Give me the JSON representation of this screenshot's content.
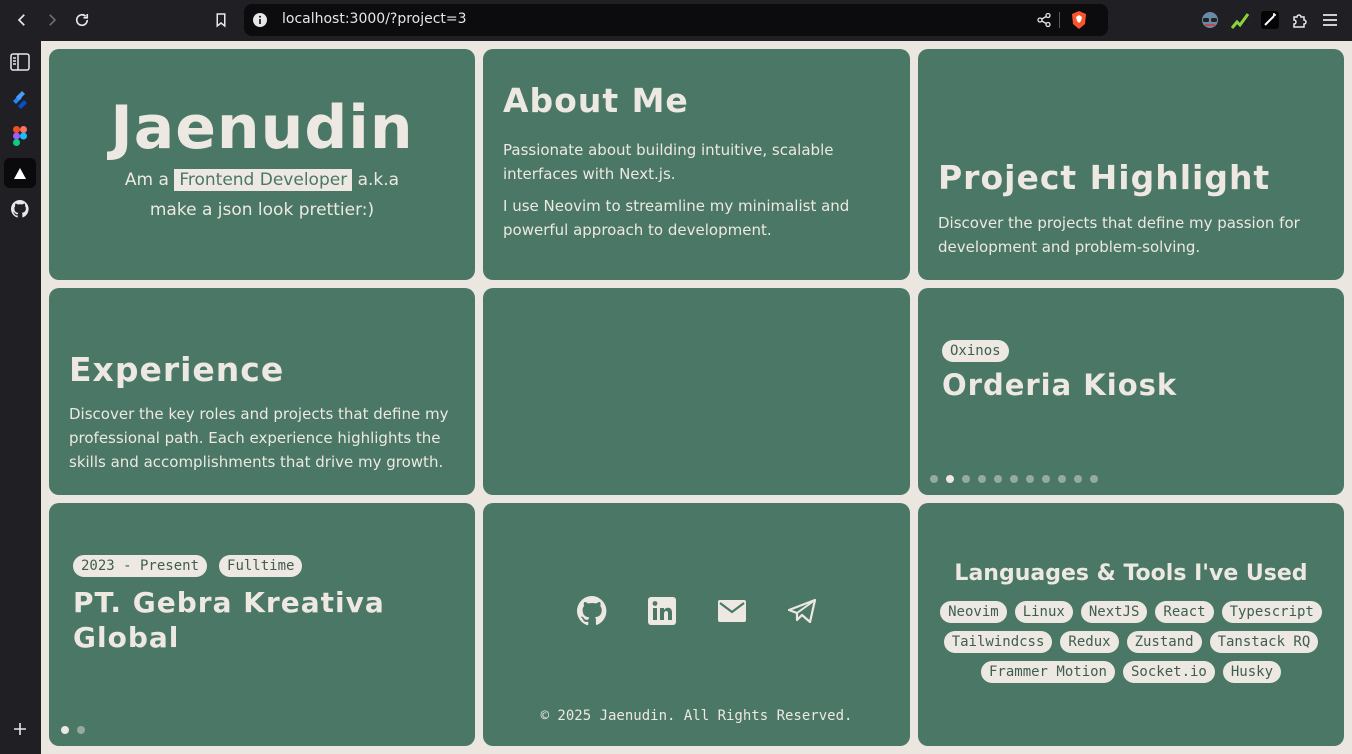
{
  "browser": {
    "url": "localhost:3000/?project=3"
  },
  "hero": {
    "name": "Jaenudin",
    "prefix": "Am a",
    "role": "Frontend Developer",
    "suffix": "a.k.a",
    "tagline": "make a json look prettier:)"
  },
  "about": {
    "title": "About Me",
    "p1": "Passionate about building intuitive, scalable interfaces with Next.js.",
    "p2": "I use Neovim to streamline my minimalist and powerful approach to development."
  },
  "projects": {
    "title": "Project Highlight",
    "description": "Discover the projects that define my passion for development and problem-solving."
  },
  "experience": {
    "title": "Experience",
    "description": "Discover the key roles and projects that define my professional path. Each experience highlights the skills and accomplishments that drive my growth."
  },
  "project_card": {
    "company": "Oxinos",
    "name": "Orderia Kiosk",
    "dot_count": 11,
    "active_index": 1
  },
  "job_card": {
    "period": "2023 - Present",
    "type": "Fulltime",
    "company": "PT. Gebra Kreativa Global",
    "dot_count": 2,
    "active_index": 0
  },
  "footer": {
    "socials": [
      "github-icon",
      "linkedin-icon",
      "mail-icon",
      "telegram-icon"
    ],
    "copyright": "© 2025 Jaenudin. All Rights Reserved."
  },
  "tools": {
    "title": "Languages & Tools I've Used",
    "items": [
      "Neovim",
      "Linux",
      "NextJS",
      "React",
      "Typescript",
      "Tailwindcss",
      "Redux",
      "Zustand",
      "Tanstack RQ",
      "Frammer Motion",
      "Socket.io",
      "Husky"
    ]
  },
  "colors": {
    "card": "#4b7866",
    "page_bg": "#ebe6df",
    "text": "#ede8e1"
  }
}
